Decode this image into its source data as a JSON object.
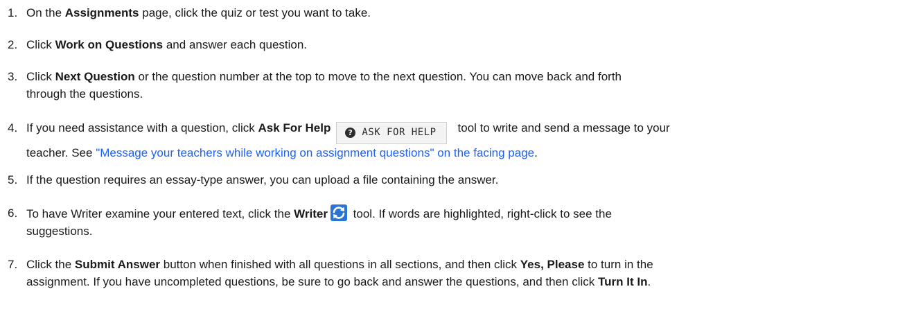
{
  "steps": [
    {
      "number": "1.",
      "pre": "On the ",
      "bold1": "Assignments",
      "post": " page, click the quiz or test you want to take."
    },
    {
      "number": "2.",
      "pre": "Click ",
      "bold1": "Work on Questions",
      "post": " and answer each question."
    },
    {
      "number": "3.",
      "pre": "Click ",
      "bold1": "Next Question",
      "post": " or the question number at the top to move to the next question. You can move back and forth",
      "line2": "through the questions."
    },
    {
      "number": "4.",
      "pre": "If you need assistance with a question, click ",
      "bold1": "Ask For Help",
      "button_label": "ASK FOR HELP",
      "post": "tool to write and send a message to your",
      "line2_pre": "teacher. See ",
      "link": "\"Message your teachers while working on assignment questions\" on the facing page",
      "line2_post": "."
    },
    {
      "number": "5.",
      "text": "If the question requires an essay-type answer, you can upload a file containing the answer."
    },
    {
      "number": "6.",
      "pre": "To have Writer examine your entered text, click the ",
      "bold1": "Writer",
      "post": " tool. If words are highlighted, right-click to see the",
      "line2": "suggestions."
    },
    {
      "number": "7.",
      "pre": "Click the ",
      "bold1": "Submit Answer",
      "mid": " button when finished with all questions in all sections, and then click ",
      "bold2": "Yes, Please",
      "post": " to turn in the",
      "line2_pre": "assignment. If you have uncompleted questions, be sure to go back and answer the questions, and then click ",
      "line2_bold": "Turn It In",
      "line2_post": "."
    }
  ],
  "icons": {
    "help": "question-circle-icon",
    "writer": "writer-refresh-icon"
  },
  "colors": {
    "link": "#1a63ff",
    "writer_icon": "#2a74d6",
    "text": "#1a1a1a"
  }
}
